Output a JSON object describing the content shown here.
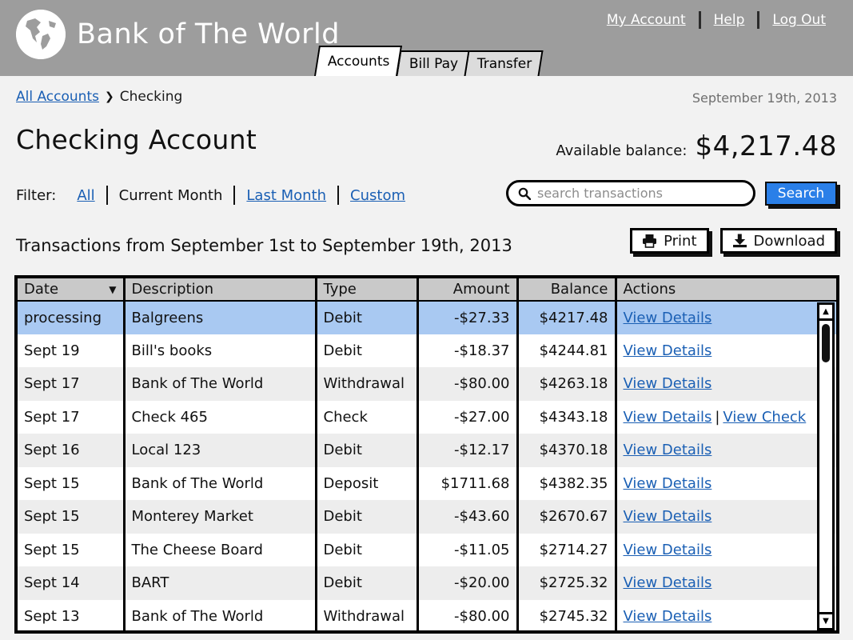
{
  "header": {
    "brand_name": "Bank of The World",
    "logo_icon": "globe-icon",
    "links": [
      {
        "label": "My Account"
      },
      {
        "label": "Help"
      },
      {
        "label": "Log Out"
      }
    ],
    "tabs": [
      {
        "label": "Accounts",
        "active": true
      },
      {
        "label": "Bill Pay",
        "active": false
      },
      {
        "label": "Transfer",
        "active": false
      }
    ],
    "colors": {
      "bar": "#9d9d9d",
      "link": "#ffffff"
    }
  },
  "breadcrumb": {
    "root_label": "All Accounts",
    "arrow": "❯",
    "current_label": "Checking"
  },
  "date_display": "September 19th, 2013",
  "page_title": "Checking Account",
  "balance": {
    "label": "Available balance:",
    "value": "$4,217.48"
  },
  "filter": {
    "label": "Filter:",
    "options": [
      {
        "label": "All",
        "active": false,
        "link": true
      },
      {
        "label": "Current Month",
        "active": true,
        "link": false
      },
      {
        "label": "Last Month",
        "active": false,
        "link": true
      },
      {
        "label": "Custom",
        "active": false,
        "link": true
      }
    ]
  },
  "search": {
    "icon": "search-icon",
    "placeholder": "search transactions",
    "value": "",
    "button_label": "Search",
    "button_color": "#2a7fe8"
  },
  "transactions_caption": "Transactions from September 1st to September 19th, 2013",
  "toolbar": {
    "print_label": "Print",
    "print_icon": "printer-icon",
    "download_label": "Download",
    "download_icon": "download-icon"
  },
  "table": {
    "sort_column": "Date",
    "sort_direction_icon": "▼",
    "columns": [
      {
        "key": "date",
        "label": "Date",
        "align": "left"
      },
      {
        "key": "description",
        "label": "Description",
        "align": "left"
      },
      {
        "key": "type",
        "label": "Type",
        "align": "left"
      },
      {
        "key": "amount",
        "label": "Amount",
        "align": "right"
      },
      {
        "key": "balance",
        "label": "Balance",
        "align": "right"
      },
      {
        "key": "actions",
        "label": "Actions",
        "align": "left"
      }
    ],
    "rows": [
      {
        "date": "processing",
        "description": "Balgreens",
        "type": "Debit",
        "amount": "-$27.33",
        "balance": "$4217.48",
        "actions": [
          "View Details"
        ],
        "highlight": true
      },
      {
        "date": "Sept 19",
        "description": "Bill's books",
        "type": "Debit",
        "amount": "-$18.37",
        "balance": "$4244.81",
        "actions": [
          "View Details"
        ],
        "highlight": false
      },
      {
        "date": "Sept 17",
        "description": "Bank of The World",
        "type": "Withdrawal",
        "amount": "-$80.00",
        "balance": "$4263.18",
        "actions": [
          "View Details"
        ],
        "highlight": false
      },
      {
        "date": "Sept 17",
        "description": "Check 465",
        "type": "Check",
        "amount": "-$27.00",
        "balance": "$4343.18",
        "actions": [
          "View Details",
          "View Check"
        ],
        "highlight": false
      },
      {
        "date": "Sept 16",
        "description": "Local 123",
        "type": "Debit",
        "amount": "-$12.17",
        "balance": "$4370.18",
        "actions": [
          "View Details"
        ],
        "highlight": false
      },
      {
        "date": "Sept 15",
        "description": "Bank of The World",
        "type": "Deposit",
        "amount": "$1711.68",
        "balance": "$4382.35",
        "actions": [
          "View Details"
        ],
        "highlight": false
      },
      {
        "date": "Sept 15",
        "description": "Monterey Market",
        "type": "Debit",
        "amount": "-$43.60",
        "balance": "$2670.67",
        "actions": [
          "View Details"
        ],
        "highlight": false
      },
      {
        "date": "Sept 15",
        "description": "The Cheese Board",
        "type": "Debit",
        "amount": "-$11.05",
        "balance": "$2714.27",
        "actions": [
          "View Details"
        ],
        "highlight": false
      },
      {
        "date": "Sept 14",
        "description": "BART",
        "type": "Debit",
        "amount": "-$20.00",
        "balance": "$2725.32",
        "actions": [
          "View Details"
        ],
        "highlight": false
      },
      {
        "date": "Sept 13",
        "description": "Bank of The World",
        "type": "Withdrawal",
        "amount": "-$80.00",
        "balance": "$2745.32",
        "actions": [
          "View Details"
        ],
        "highlight": false
      }
    ],
    "action_separator": "|",
    "highlight_color": "#a9c9f2",
    "header_color": "#c9c9c9",
    "link_color": "#1a5fb4"
  },
  "scrollbar": {
    "up_icon": "▲",
    "down_icon": "▼"
  }
}
